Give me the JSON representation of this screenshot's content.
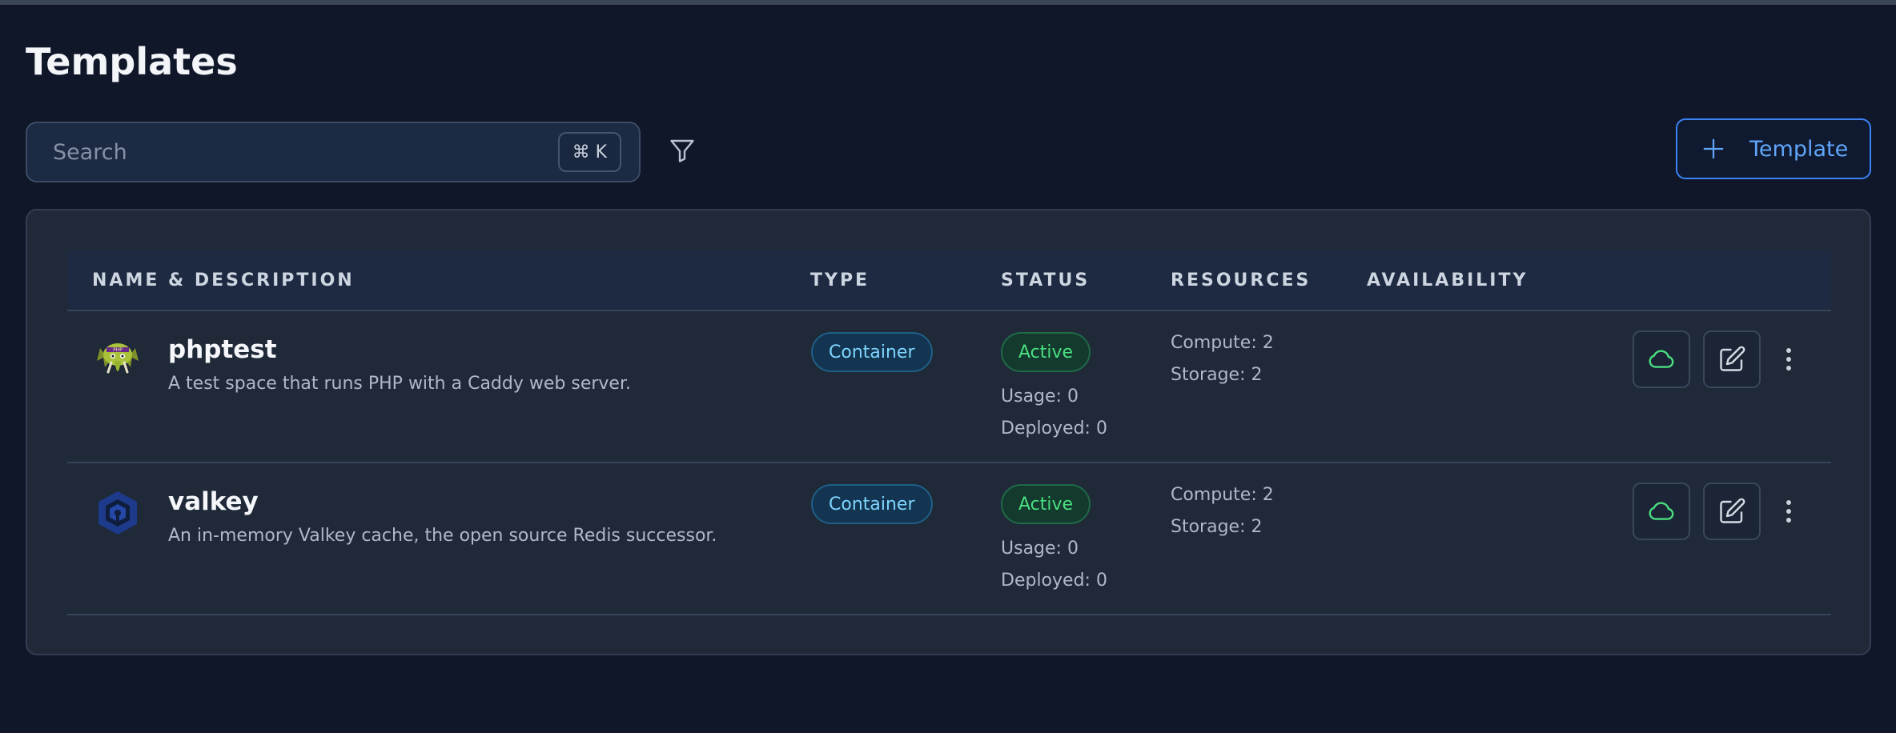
{
  "page": {
    "title": "Templates"
  },
  "search": {
    "placeholder": "Search",
    "value": "",
    "shortcut": "⌘ K"
  },
  "toolbar": {
    "filter_icon": "filter-icon",
    "add_label": "Template",
    "add_icon": "plus-icon"
  },
  "table": {
    "headers": [
      "NAME & DESCRIPTION",
      "TYPE",
      "STATUS",
      "RESOURCES",
      "AVAILABILITY"
    ],
    "rows": [
      {
        "icon": "php-elephant-logo",
        "name": "phptest",
        "description": "A test space that runs PHP with a Caddy web server.",
        "type": "Container",
        "status": "Active",
        "usage": "Usage: 0",
        "deployed": "Deployed: 0",
        "compute": "Compute: 2",
        "storage": "Storage: 2"
      },
      {
        "icon": "valkey-logo",
        "name": "valkey",
        "description": "An in-memory Valkey cache, the open source Redis successor.",
        "type": "Container",
        "status": "Active",
        "usage": "Usage: 0",
        "deployed": "Deployed: 0",
        "compute": "Compute: 2",
        "storage": "Storage: 2"
      }
    ]
  },
  "colors": {
    "background": "#0f1729",
    "accent": "#3b82f6",
    "status_active": "#4ade80",
    "type_badge": "#7dd3fc"
  }
}
